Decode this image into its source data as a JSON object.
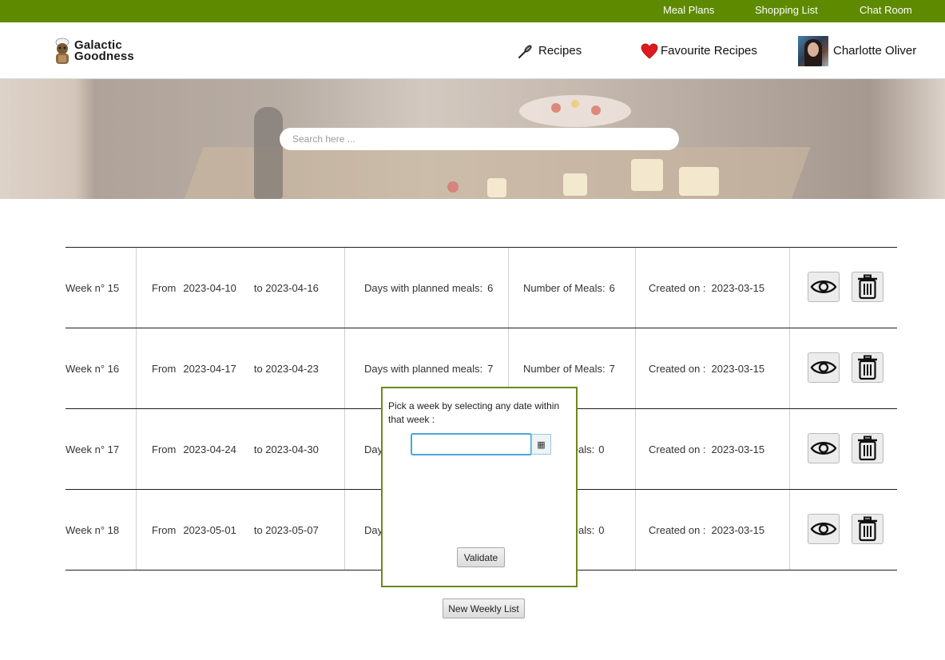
{
  "topnav": {
    "meal_plans": "Meal Plans",
    "shopping_list": "Shopping List",
    "chat_room": "Chat Room"
  },
  "header": {
    "logo_line1": "Galactic",
    "logo_line2": "Goodness",
    "recipes": "Recipes",
    "favourite_recipes": "Favourite Recipes",
    "user_name": "Charlotte Oliver"
  },
  "search": {
    "placeholder": "Search here ..."
  },
  "weeks": [
    {
      "week": "Week n° 15",
      "from_label": "From",
      "from": "2023-04-10",
      "to": "to 2023-04-16",
      "days_label": "Days with planned meals:",
      "days": "6",
      "meals_label": "Number of Meals:",
      "meals": "6",
      "created_label": "Created on :",
      "created": "2023-03-15"
    },
    {
      "week": "Week n° 16",
      "from_label": "From",
      "from": "2023-04-17",
      "to": "to 2023-04-23",
      "days_label": "Days with planned meals:",
      "days": "7",
      "meals_label": "Number of Meals:",
      "meals": "7",
      "created_label": "Created on :",
      "created": "2023-03-15"
    },
    {
      "week": "Week n° 17",
      "from_label": "From",
      "from": "2023-04-24",
      "to": "to 2023-04-30",
      "days_label": "Day",
      "days": "",
      "meals_label": "Meals:",
      "meals": "0",
      "created_label": "Created on :",
      "created": "2023-03-15"
    },
    {
      "week": "Week n° 18",
      "from_label": "From",
      "from": "2023-05-01",
      "to": "to 2023-05-07",
      "days_label": "Day",
      "days": "",
      "meals_label": "Meals:",
      "meals": "0",
      "created_label": "Created on :",
      "created": "2023-03-15"
    }
  ],
  "popup": {
    "message": "Pick a week by selecting any date within that week :",
    "date_value": "",
    "calendar_glyph": "▦",
    "validate": "Validate"
  },
  "footer": {
    "new_weekly_list": "New Weekly List"
  },
  "colors": {
    "topbar": "#5e8a00",
    "popup_border": "#6a8a1a",
    "input_focus": "#4aa6d8",
    "heart": "#e0191f"
  },
  "icons": {
    "recipes": "whisk-icon",
    "favourites": "heart-icon",
    "view": "eye-icon",
    "delete": "trash-icon",
    "calendar": "calendar-icon"
  }
}
